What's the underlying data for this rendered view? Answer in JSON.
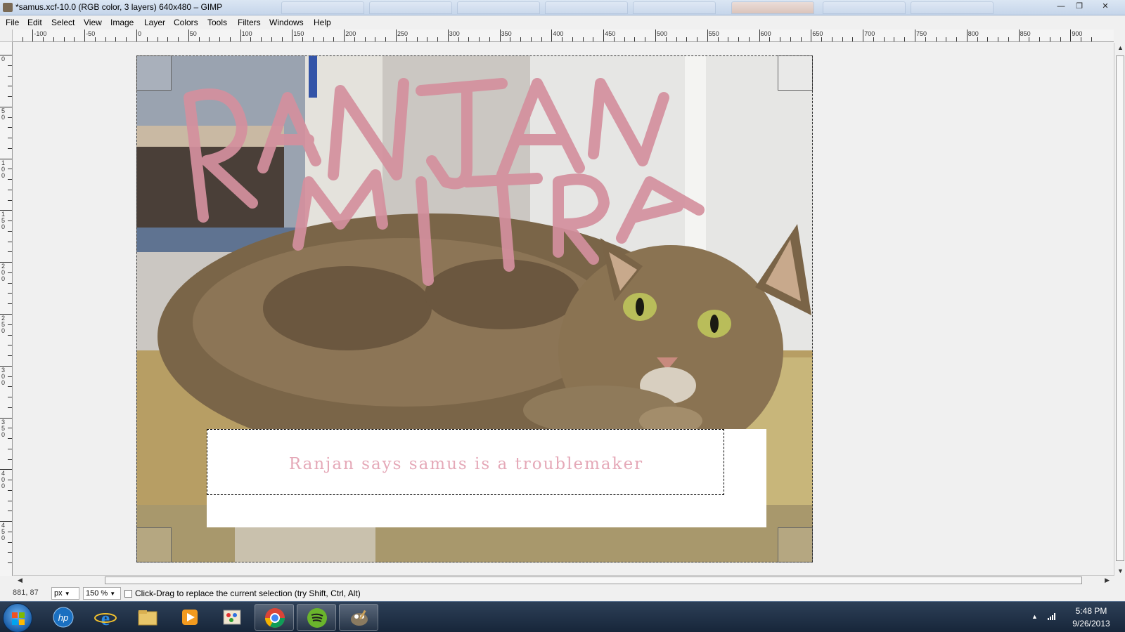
{
  "window": {
    "title": "*samus.xcf-10.0 (RGB color, 3 layers) 640x480 – GIMP",
    "controls": {
      "minimize": "—",
      "maximize": "❐",
      "close": "✕"
    }
  },
  "menubar": {
    "items": [
      "File",
      "Edit",
      "Select",
      "View",
      "Image",
      "Layer",
      "Colors",
      "Tools",
      "Filters",
      "Windows",
      "Help"
    ]
  },
  "ruler": {
    "horizontal_labels": [
      "-100",
      "-50",
      "0",
      "50",
      "100",
      "150",
      "200",
      "250",
      "300",
      "350",
      "400",
      "450",
      "500",
      "550",
      "600",
      "650",
      "700",
      "750",
      "800",
      "850",
      "900"
    ],
    "vertical_labels": [
      "0",
      "50",
      "100",
      "150",
      "200",
      "250",
      "300",
      "350",
      "400",
      "450"
    ]
  },
  "canvas": {
    "caption_text": "Ranjan says samus is a troublemaker",
    "painted_text_line1": "RANJAN",
    "painted_text_line2": "MITRA",
    "paint_color": "#d4909e",
    "caption_color": "#e5a9b8"
  },
  "statusbar": {
    "coords": "881, 87",
    "unit": "px",
    "zoom": "150 %",
    "message": "Click-Drag to replace the current selection (try Shift, Ctrl, Alt)"
  },
  "taskbar": {
    "apps": [
      "HP",
      "Internet Explorer",
      "Windows Explorer",
      "Media Player",
      "Paint",
      "Google Chrome",
      "Spotify",
      "GIMP"
    ],
    "time": "5:48 PM",
    "date": "9/26/2013"
  }
}
